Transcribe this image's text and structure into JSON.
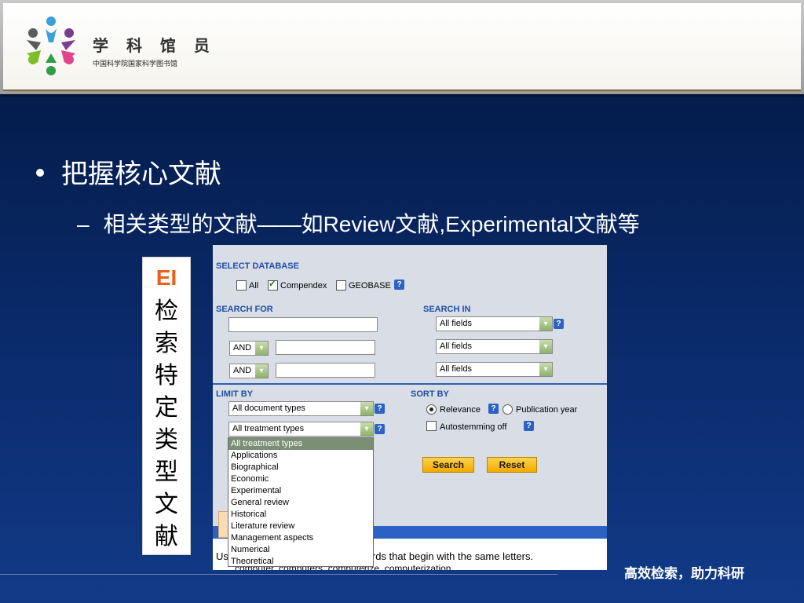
{
  "header": {
    "logo_title": "学 科 馆 员",
    "logo_subtitle": "中国科学院国家科学图书馆",
    "logo_icon": "people-circle-logo"
  },
  "content": {
    "bullet1": "把握核心文献",
    "bullet2_dash": "–",
    "bullet2": "相关类型的文献——如Review文献,Experimental文献等"
  },
  "ei_box": {
    "label": "EI",
    "chars": [
      "检",
      "索",
      "特",
      "定",
      "类",
      "型",
      "文",
      "献"
    ]
  },
  "panel": {
    "select_database": {
      "title": "SELECT DATABASE",
      "options": [
        {
          "label": "All",
          "checked": false
        },
        {
          "label": "Compendex",
          "checked": true
        },
        {
          "label": "GEOBASE",
          "checked": false
        }
      ],
      "help": "?"
    },
    "search_for": {
      "title": "SEARCH FOR",
      "rows": [
        {
          "operator": "",
          "value": ""
        },
        {
          "operator": "AND",
          "value": ""
        },
        {
          "operator": "AND",
          "value": ""
        }
      ]
    },
    "search_in": {
      "title": "SEARCH IN",
      "fields": [
        "All fields",
        "All fields",
        "All fields"
      ]
    },
    "limit_by": {
      "title": "LIMIT BY",
      "document_type": "All document types",
      "treatment_type": "All treatment types"
    },
    "sort_by": {
      "title": "SORT BY",
      "relevance": "Relevance",
      "publication_year": "Publication year",
      "autostemming": "Autostemming off",
      "selected": "Relevance"
    },
    "buttons": {
      "search": "Search",
      "reset": "Reset"
    },
    "lower": {
      "bar_label": "Se",
      "text_prefix": "Us",
      "text_suffix": "rds that begin with the same letters.",
      "text_line2": "computer, computers, computerize, computerization"
    }
  },
  "dropdown": {
    "items": [
      "All treatment types",
      "Applications",
      "Biographical",
      "Economic",
      "Experimental",
      "General review",
      "Historical",
      "Literature review",
      "Management aspects",
      "Numerical",
      "Theoretical"
    ],
    "selected_index": 0,
    "highlighted": [
      "Historical",
      "Literature review"
    ]
  },
  "footer": {
    "slogan": "高效检索，助力科研"
  },
  "colors": {
    "background": "#0a2a6a",
    "ei_accent": "#e8621d",
    "panel_heading": "#1f4ea5",
    "button": "#f1a800"
  }
}
